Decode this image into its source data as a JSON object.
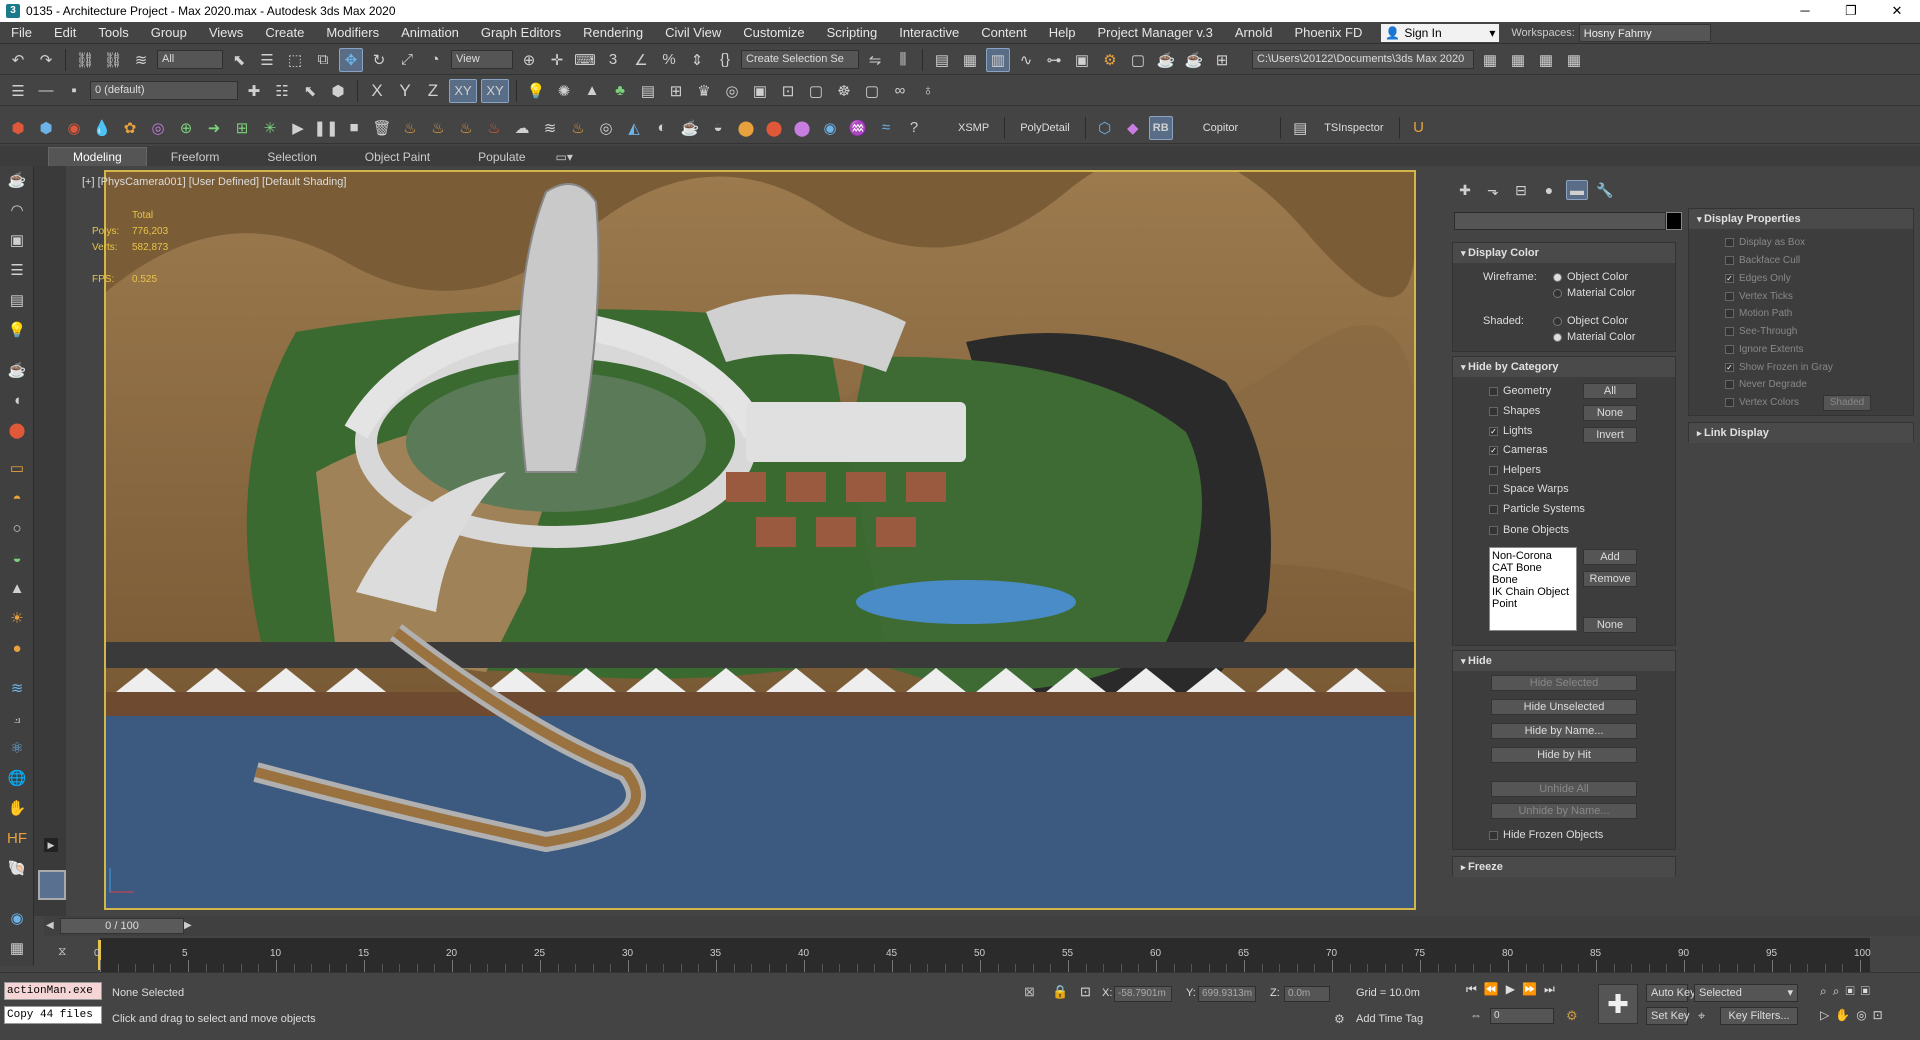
{
  "window": {
    "title": "0135 - Architecture Project - Max 2020.max - Autodesk 3ds Max 2020",
    "minimize": "─",
    "maximize": "❐",
    "close": "✕"
  },
  "menu": [
    "File",
    "Edit",
    "Tools",
    "Group",
    "Views",
    "Create",
    "Modifiers",
    "Animation",
    "Graph Editors",
    "Rendering",
    "Civil View",
    "Customize",
    "Scripting",
    "Interactive",
    "Content",
    "Help",
    "Project Manager v.3",
    "Arnold",
    "Phoenix FD"
  ],
  "account": {
    "signin": "Sign In",
    "workspaces_label": "Workspaces:",
    "workspace": "Hosny Fahmy"
  },
  "toolbar1": {
    "filter": "All",
    "view": "View",
    "selection_set": "Create Selection Se",
    "path": "C:\\Users\\20122\\Documents\\3ds Max 2020"
  },
  "toolbar2": {
    "layer": "0 (default)",
    "x": "X",
    "y": "Y",
    "z": "Z",
    "xy": "XY",
    "xy2": "XY"
  },
  "toolbar3": {
    "xsmp": "XSMP",
    "polydetail": "PolyDetail",
    "rb": "RB",
    "copitor": "Copitor",
    "tsinspector": "TSInspector"
  },
  "ribbon": {
    "tabs": [
      "Modeling",
      "Freeform",
      "Selection",
      "Object Paint",
      "Populate"
    ]
  },
  "viewport": {
    "label": "[+] [PhysCamera001] [User Defined] [Default Shading]",
    "total": "Total",
    "polys_label": "Polys:",
    "polys": "776,203",
    "verts_label": "Verts:",
    "verts": "582,873",
    "fps_label": "FPS:",
    "fps": "0.525"
  },
  "display_color": {
    "title": "Display Color",
    "wireframe": "Wireframe:",
    "shaded": "Shaded:",
    "object_color": "Object Color",
    "material_color": "Material Color"
  },
  "hide_by_category": {
    "title": "Hide by Category",
    "items": [
      {
        "label": "Geometry",
        "checked": false
      },
      {
        "label": "Shapes",
        "checked": false
      },
      {
        "label": "Lights",
        "checked": true
      },
      {
        "label": "Cameras",
        "checked": true
      },
      {
        "label": "Helpers",
        "checked": false
      },
      {
        "label": "Space Warps",
        "checked": false
      },
      {
        "label": "Particle Systems",
        "checked": false
      },
      {
        "label": "Bone Objects",
        "checked": false
      }
    ],
    "all": "All",
    "none": "None",
    "invert": "Invert",
    "list": [
      "Non-Corona",
      "CAT Bone",
      "Bone",
      "IK Chain Object",
      "Point"
    ],
    "add": "Add",
    "remove": "Remove",
    "none2": "None"
  },
  "hide": {
    "title": "Hide",
    "hide_selected": "Hide Selected",
    "hide_unselected": "Hide Unselected",
    "hide_by_name": "Hide by Name...",
    "hide_by_hit": "Hide by Hit",
    "unhide_all": "Unhide All",
    "unhide_by_name": "Unhide by Name...",
    "hide_frozen": "Hide Frozen Objects"
  },
  "freeze": {
    "title": "Freeze"
  },
  "display_properties": {
    "title": "Display Properties",
    "items": [
      {
        "label": "Display as Box",
        "checked": false
      },
      {
        "label": "Backface Cull",
        "checked": false
      },
      {
        "label": "Edges Only",
        "checked": true
      },
      {
        "label": "Vertex Ticks",
        "checked": false
      },
      {
        "label": "Motion Path",
        "checked": false
      },
      {
        "label": "See-Through",
        "checked": false
      },
      {
        "label": "Ignore Extents",
        "checked": false
      },
      {
        "label": "Show Frozen in Gray",
        "checked": true
      },
      {
        "label": "Never Degrade",
        "checked": false
      },
      {
        "label": "Vertex Colors",
        "checked": false
      }
    ],
    "shaded_btn": "Shaded"
  },
  "link_display": {
    "title": "Link Display"
  },
  "timeline": {
    "frame": "0 / 100",
    "ticks": [
      "0",
      "5",
      "10",
      "15",
      "20",
      "25",
      "30",
      "35",
      "40",
      "45",
      "50",
      "55",
      "60",
      "65",
      "70",
      "75",
      "80",
      "85",
      "90",
      "95",
      "100"
    ]
  },
  "status": {
    "maxscript1": "actionMan.exe",
    "maxscript2": "Copy 44 files",
    "selection": "None Selected",
    "prompt": "Click and drag to select and move objects",
    "x_label": "X:",
    "x": "-58.7901m",
    "y_label": "Y:",
    "y": "699.9313m",
    "z_label": "Z:",
    "z": "0.0m",
    "grid": "Grid = 10.0m",
    "add_time_tag": "Add Time Tag",
    "auto_key": "Auto Key",
    "set_key": "Set Key",
    "selected": "Selected",
    "key_filters": "Key Filters...",
    "frame": "0"
  },
  "colors": {
    "viewport_border": "#d4b74a",
    "stats": "#e8c548",
    "water": "#3c5a80",
    "sand": "#8a6a40"
  }
}
